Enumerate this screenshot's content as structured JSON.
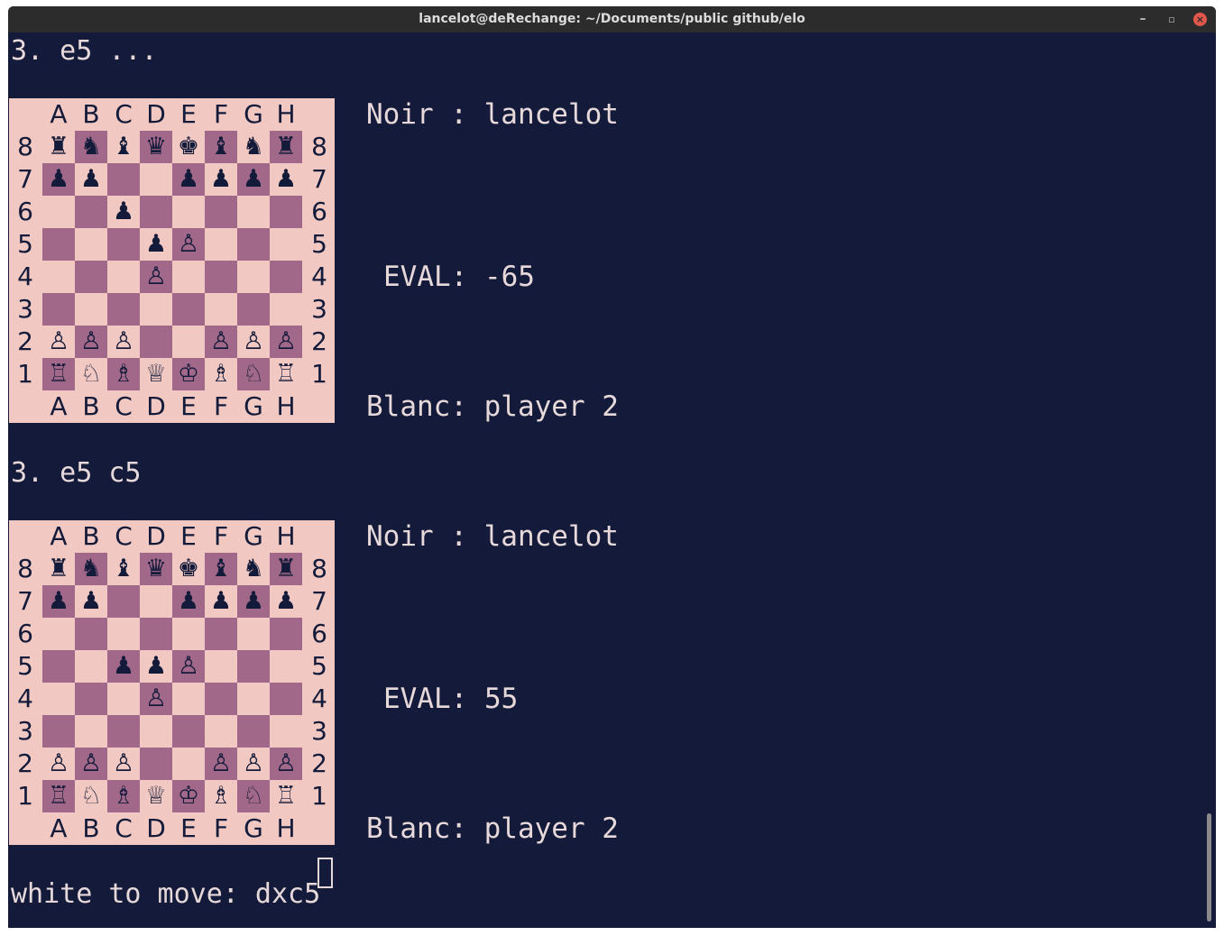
{
  "window": {
    "title": "lancelot@deRechange: ~/Documents/public github/elo",
    "min_label": "–",
    "max_label": "▫",
    "close_label": "×"
  },
  "colors": {
    "background": "#131a3a",
    "text": "#e7d8da",
    "light_square": "#f1c9c2",
    "dark_square": "#a26889",
    "piece": "#131a3a"
  },
  "files": [
    "A",
    "B",
    "C",
    "D",
    "E",
    "F",
    "G",
    "H"
  ],
  "ranks": [
    "8",
    "7",
    "6",
    "5",
    "4",
    "3",
    "2",
    "1"
  ],
  "blocks": [
    {
      "move": "3. e5 ...",
      "noir": "Noir : lancelot",
      "eval": "EVAL: -65",
      "blanc": "Blanc: player 2",
      "board": [
        [
          "♜",
          "♞",
          "♝",
          "♛",
          "♚",
          "♝",
          "♞",
          "♜"
        ],
        [
          "♟",
          "♟",
          "",
          "",
          "♟",
          "♟",
          "♟",
          "♟"
        ],
        [
          "",
          "",
          "♟",
          "",
          "",
          "",
          "",
          ""
        ],
        [
          "",
          "",
          "",
          "♟",
          "♙",
          "",
          "",
          ""
        ],
        [
          "",
          "",
          "",
          "♙",
          "",
          "",
          "",
          ""
        ],
        [
          "",
          "",
          "",
          "",
          "",
          "",
          "",
          ""
        ],
        [
          "♙",
          "♙",
          "♙",
          "",
          "",
          "♙",
          "♙",
          "♙"
        ],
        [
          "♖",
          "♘",
          "♗",
          "♕",
          "♔",
          "♗",
          "♘",
          "♖"
        ]
      ]
    },
    {
      "move": "3. e5 c5",
      "noir": "Noir : lancelot",
      "eval": "EVAL: 55",
      "blanc": "Blanc: player 2",
      "board": [
        [
          "♜",
          "♞",
          "♝",
          "♛",
          "♚",
          "♝",
          "♞",
          "♜"
        ],
        [
          "♟",
          "♟",
          "",
          "",
          "♟",
          "♟",
          "♟",
          "♟"
        ],
        [
          "",
          "",
          "",
          "",
          "",
          "",
          "",
          ""
        ],
        [
          "",
          "",
          "♟",
          "♟",
          "♙",
          "",
          "",
          ""
        ],
        [
          "",
          "",
          "",
          "♙",
          "",
          "",
          "",
          ""
        ],
        [
          "",
          "",
          "",
          "",
          "",
          "",
          "",
          ""
        ],
        [
          "♙",
          "♙",
          "♙",
          "",
          "",
          "♙",
          "♙",
          "♙"
        ],
        [
          "♖",
          "♘",
          "♗",
          "♕",
          "♔",
          "♗",
          "♘",
          "♖"
        ]
      ]
    }
  ],
  "prompt": "white to move: dxc5"
}
